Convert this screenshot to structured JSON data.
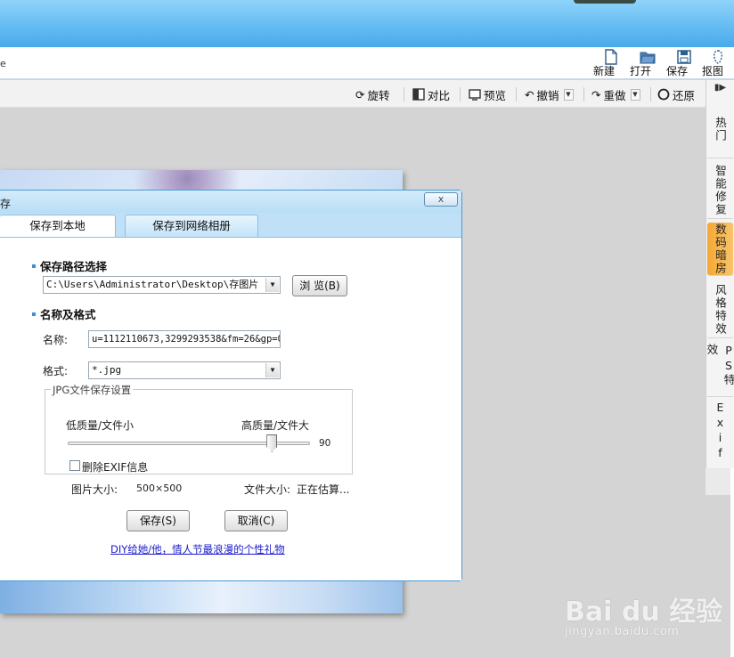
{
  "toolbar": {
    "edge_text": "e",
    "new_label": "新建",
    "open_label": "打开",
    "save_label": "保存",
    "capture_label": "抠图"
  },
  "edit_toolbar": {
    "rotate_label": "旋转",
    "compare_label": "对比",
    "preview_label": "预览",
    "undo_label": "撤销",
    "redo_label": "重做",
    "restore_label": "还原"
  },
  "side_panel": {
    "items": [
      {
        "label": "热门",
        "active": false
      },
      {
        "label": "智能修复",
        "active": false
      },
      {
        "label": "数码暗房",
        "active": true
      },
      {
        "label": "风格特效",
        "active": false
      },
      {
        "label": "PS特效",
        "active": false
      },
      {
        "label": "Exif",
        "active": false
      }
    ]
  },
  "dialog": {
    "title": "存",
    "close_label": "x",
    "tabs": [
      {
        "label": "保存到本地",
        "active": true
      },
      {
        "label": "保存到网络相册",
        "active": false
      }
    ],
    "path_section": {
      "heading": "保存路径选择",
      "path_value": "C:\\Users\\Administrator\\Desktop\\存图片",
      "browse_label": "浏 览(B)"
    },
    "name_section": {
      "heading": "名称及格式",
      "name_label": "名称:",
      "name_value": "u=1112110673,3299293538&fm=26&gp=0_",
      "format_label": "格式:",
      "format_value": "*.jpg"
    },
    "jpg_settings": {
      "legend": "JPG文件保存设置",
      "low_label": "低质量/文件小",
      "high_label": "高质量/文件大",
      "quality_value": "90",
      "quality_fraction": 0.9,
      "remove_exif_label": "删除EXIF信息",
      "remove_exif_checked": false
    },
    "image_size_label": "图片大小:",
    "image_size_value": "500×500",
    "file_size_label": "文件大小:",
    "file_size_value": "正在估算...",
    "save_button_label": "保存(S)",
    "cancel_button_label": "取消(C)",
    "promo_link": "DIY给她/他，情人节最浪漫的个性礼物"
  },
  "watermark": {
    "brand": "Bai du 经验",
    "url": "jingyan.baidu.com"
  },
  "colors": {
    "titlebar": "#62baf2",
    "dialog_border": "#4a9bd6",
    "active_side_item": "#f5a834",
    "link": "#1a1acc"
  }
}
